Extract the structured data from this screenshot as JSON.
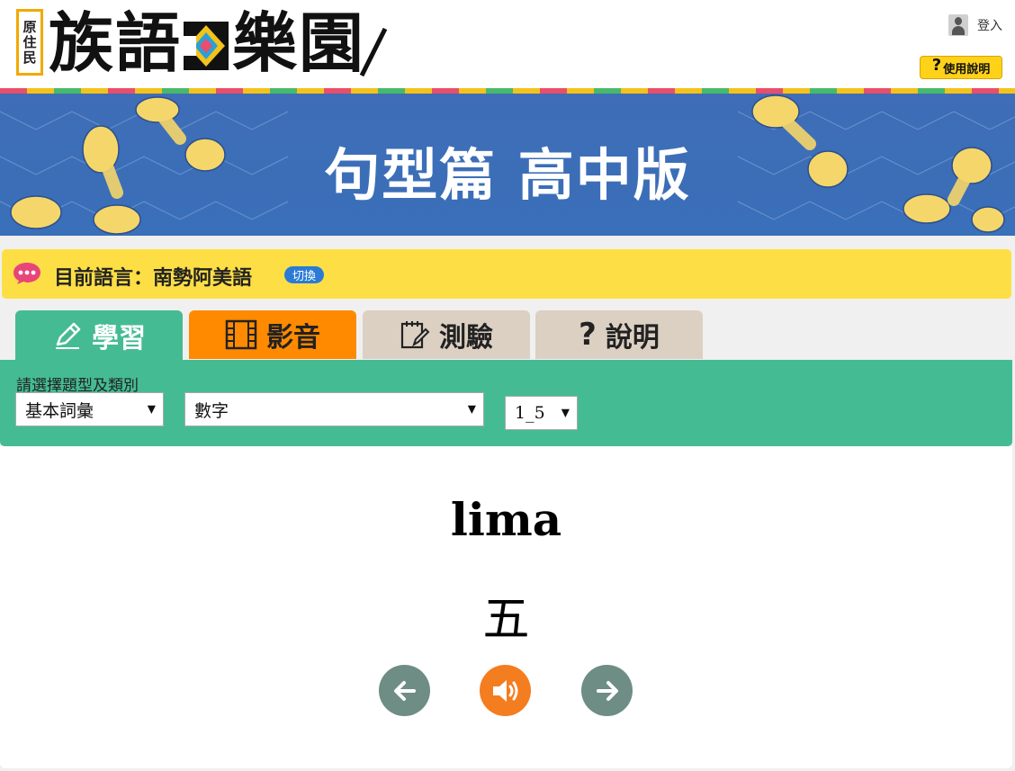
{
  "header": {
    "logo_tag": [
      "原",
      "住",
      "民"
    ],
    "logo_text_left": "族語",
    "logo_text_right": "樂園",
    "login_label": "登入",
    "help_label": "使用說明"
  },
  "banner": {
    "title": "句型篇  高中版"
  },
  "language": {
    "current_label": "目前語言：南勢阿美語",
    "switch_label": "切換"
  },
  "tabs": [
    {
      "label": "學習",
      "icon": "pencil-icon",
      "active": true,
      "color": "#45bb94"
    },
    {
      "label": "影音",
      "icon": "film-icon",
      "active": false,
      "color": "#ff8a00"
    },
    {
      "label": "測驗",
      "icon": "notepad-icon",
      "active": false,
      "color": "#dcd0c3"
    },
    {
      "label": "說明",
      "icon": "question-icon",
      "active": false,
      "color": "#dcd0c3"
    }
  ],
  "filter": {
    "label": "請選擇題型及類別",
    "type_value": "基本詞彙",
    "category_value": "數字",
    "range_value": "1_5"
  },
  "card": {
    "word": "lima",
    "meaning": "五"
  },
  "controls": {
    "prev": "arrow-left-icon",
    "audio": "speaker-icon",
    "next": "arrow-right-icon"
  },
  "colors": {
    "accent_green": "#45bb94",
    "accent_orange": "#ff8a00",
    "banner_blue": "#3f6db7",
    "lang_yellow": "#fddf45"
  }
}
